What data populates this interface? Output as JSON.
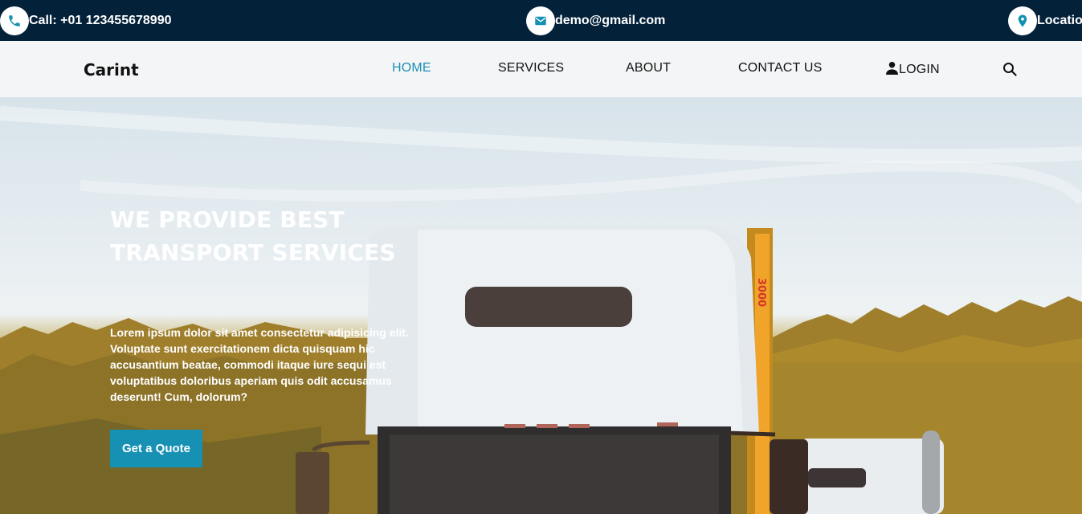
{
  "topbar": {
    "phone": {
      "icon": "phone-icon",
      "text": "Call: +01 123455678990"
    },
    "email": {
      "icon": "envelope-icon",
      "text": "demo@gmail.com"
    },
    "location": {
      "icon": "map-pin-icon",
      "text": "Location"
    }
  },
  "navbar": {
    "brand": "Carint",
    "links": [
      {
        "label": "HOME",
        "active": true
      },
      {
        "label": "SERVICES",
        "active": false
      },
      {
        "label": "ABOUT",
        "active": false
      },
      {
        "label": "CONTACT US",
        "active": false
      }
    ],
    "login": {
      "icon": "user-icon",
      "label": "LOGIN"
    },
    "search_icon": "search-icon"
  },
  "hero": {
    "title": "WE PROVIDE BEST TRANSPORT SERVICES",
    "text": "Lorem ipsum dolor sit amet consectetur adipisicing elit. Voluptate sunt exercitationem dicta quisquam hic accusantium beatae, commodi itaque iure sequi est voluptatibus doloribus aperiam quis odit accusamus deserunt! Cum, dolorum?",
    "button_label": "Get a Quote",
    "truck_marking": "3000"
  },
  "colors": {
    "topbar_bg": "#04213a",
    "nav_bg": "#f4f5f6",
    "accent": "#1691b4",
    "active_link": "#1b8fb5"
  }
}
